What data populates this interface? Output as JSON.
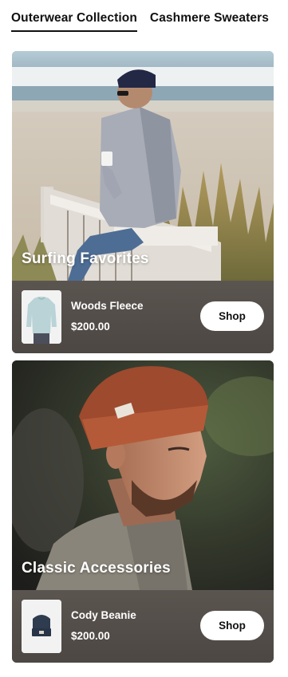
{
  "tabs": [
    {
      "label": "Outerwear Collection",
      "active": true
    },
    {
      "label": "Cashmere Sweaters",
      "active": false
    }
  ],
  "cards": [
    {
      "hero_title": "Surfing Favorites",
      "product": {
        "name": "Woods Fleece",
        "price": "$200.00",
        "thumb": "fleece-sweater-image"
      },
      "shop_label": "Shop"
    },
    {
      "hero_title": "Classic Accessories",
      "product": {
        "name": "Cody Beanie",
        "price": "$200.00",
        "thumb": "beanie-image"
      },
      "shop_label": "Shop"
    }
  ]
}
